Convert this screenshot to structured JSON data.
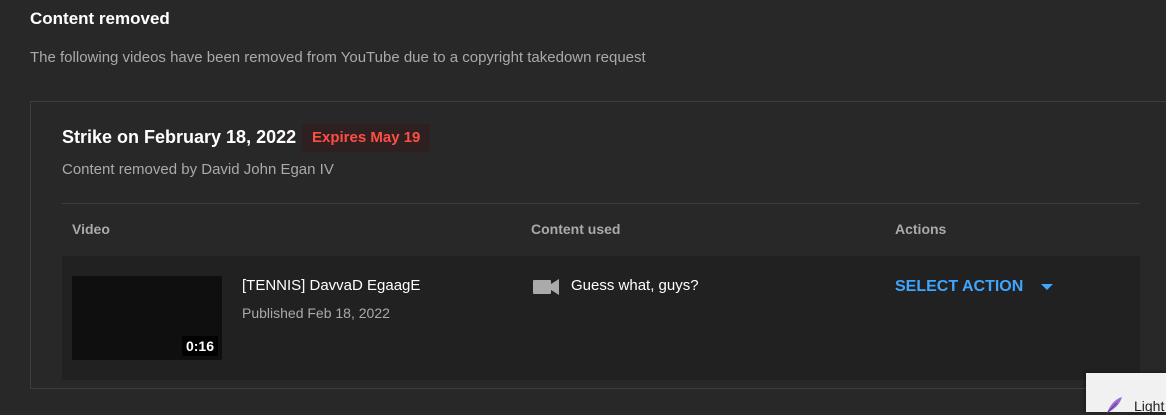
{
  "section": {
    "title": "Content removed",
    "description": "The following videos have been removed from YouTube due to a copyright takedown request"
  },
  "strike": {
    "title": "Strike on February 18, 2022",
    "expires": "Expires May 19",
    "removed_by": "Content removed by David John Egan IV",
    "table": {
      "headers": {
        "video": "Video",
        "content_used": "Content used",
        "actions": "Actions"
      },
      "rows": [
        {
          "duration": "0:16",
          "video_title": "[TENNIS] DavvaD EgaagE",
          "published": "Published Feb 18, 2022",
          "content_icon": "video-camera-icon",
          "content_used": "Guess what, guys?",
          "action_label": "SELECT ACTION"
        }
      ]
    }
  },
  "corner_widget": {
    "label": "Light",
    "icon": "feather-icon"
  },
  "colors": {
    "accent": "#3ea6ff",
    "expires": "#ff4e45",
    "background": "#282828"
  }
}
